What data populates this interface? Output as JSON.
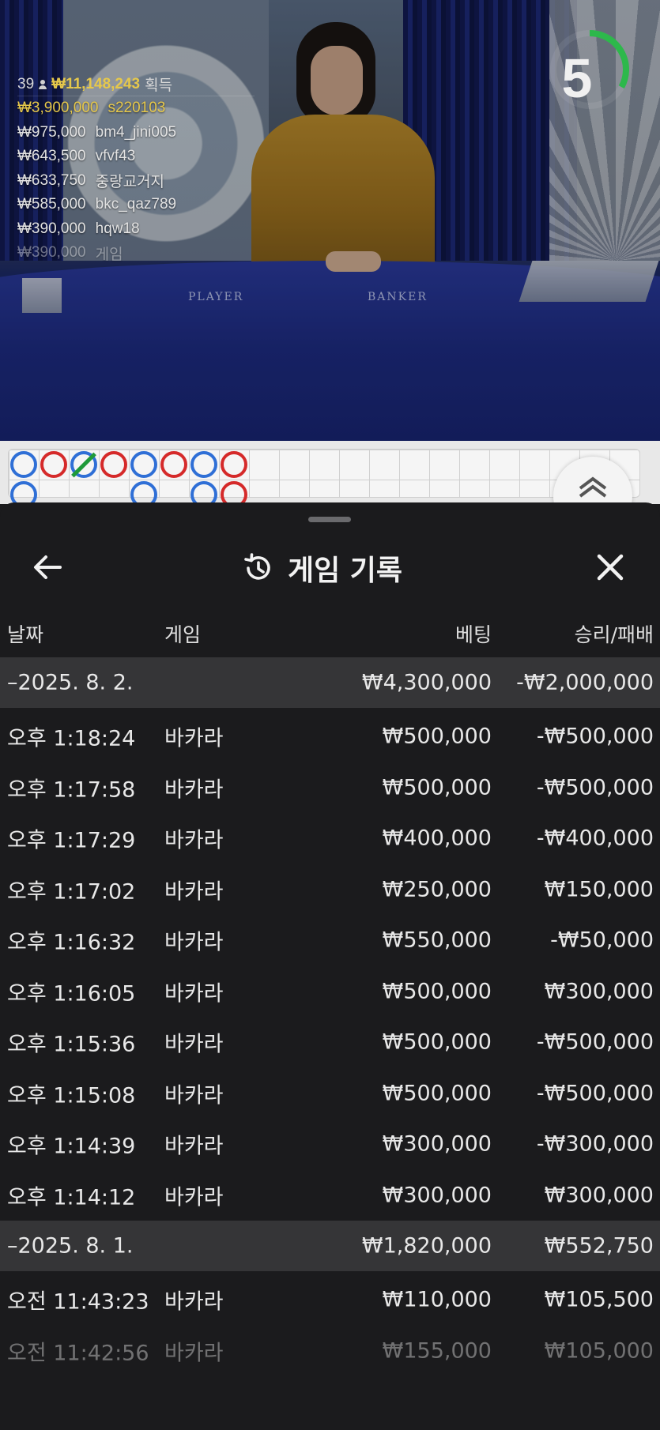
{
  "stream": {
    "winners": {
      "count": "39",
      "total": "₩11,148,243",
      "total_suffix": "획득",
      "rows": [
        {
          "amount": "₩3,900,000",
          "user": "s220103"
        },
        {
          "amount": "₩975,000",
          "user": "bm4_jini005"
        },
        {
          "amount": "₩643,500",
          "user": "vfvf43"
        },
        {
          "amount": "₩633,750",
          "user": "중랑교거지"
        },
        {
          "amount": "₩585,000",
          "user": "bkc_qaz789"
        },
        {
          "amount": "₩390,000",
          "user": "hqw18"
        },
        {
          "amount": "₩390,000",
          "user": "게임"
        }
      ]
    },
    "timer": {
      "seconds": "5",
      "remaining_fraction": 0.33
    },
    "table_labels": {
      "player": "PLAYER",
      "banker": "BANKER"
    },
    "colors": {
      "gold": "#e6c84b",
      "player_blue": "#2f6fd6",
      "banker_red": "#d52a2a",
      "tie_green": "#1f9a3a",
      "timer_green": "#2db84b"
    }
  },
  "sheet": {
    "title": "게임 기록",
    "columns": {
      "date": "날짜",
      "game": "게임",
      "bet": "베팅",
      "result": "승리/패배"
    },
    "groups": [
      {
        "date": "–2025. 8. 2.",
        "bet": "₩4,300,000",
        "result": "-₩2,000,000",
        "rows": [
          {
            "time": "오후 1:18:24",
            "game": "바카라",
            "bet": "₩500,000",
            "result": "-₩500,000"
          },
          {
            "time": "오후 1:17:58",
            "game": "바카라",
            "bet": "₩500,000",
            "result": "-₩500,000"
          },
          {
            "time": "오후 1:17:29",
            "game": "바카라",
            "bet": "₩400,000",
            "result": "-₩400,000"
          },
          {
            "time": "오후 1:17:02",
            "game": "바카라",
            "bet": "₩250,000",
            "result": "₩150,000"
          },
          {
            "time": "오후 1:16:32",
            "game": "바카라",
            "bet": "₩550,000",
            "result": "-₩50,000"
          },
          {
            "time": "오후 1:16:05",
            "game": "바카라",
            "bet": "₩500,000",
            "result": "₩300,000"
          },
          {
            "time": "오후 1:15:36",
            "game": "바카라",
            "bet": "₩500,000",
            "result": "-₩500,000"
          },
          {
            "time": "오후 1:15:08",
            "game": "바카라",
            "bet": "₩500,000",
            "result": "-₩500,000"
          },
          {
            "time": "오후 1:14:39",
            "game": "바카라",
            "bet": "₩300,000",
            "result": "-₩300,000"
          },
          {
            "time": "오후 1:14:12",
            "game": "바카라",
            "bet": "₩300,000",
            "result": "₩300,000"
          }
        ]
      },
      {
        "date": "–2025. 8. 1.",
        "bet": "₩1,820,000",
        "result": "₩552,750",
        "rows": [
          {
            "time": "오전 11:43:23",
            "game": "바카라",
            "bet": "₩110,000",
            "result": "₩105,500"
          },
          {
            "time": "오전 11:42:56",
            "game": "바카라",
            "bet": "₩155,000",
            "result": "₩105,000"
          }
        ]
      }
    ]
  }
}
